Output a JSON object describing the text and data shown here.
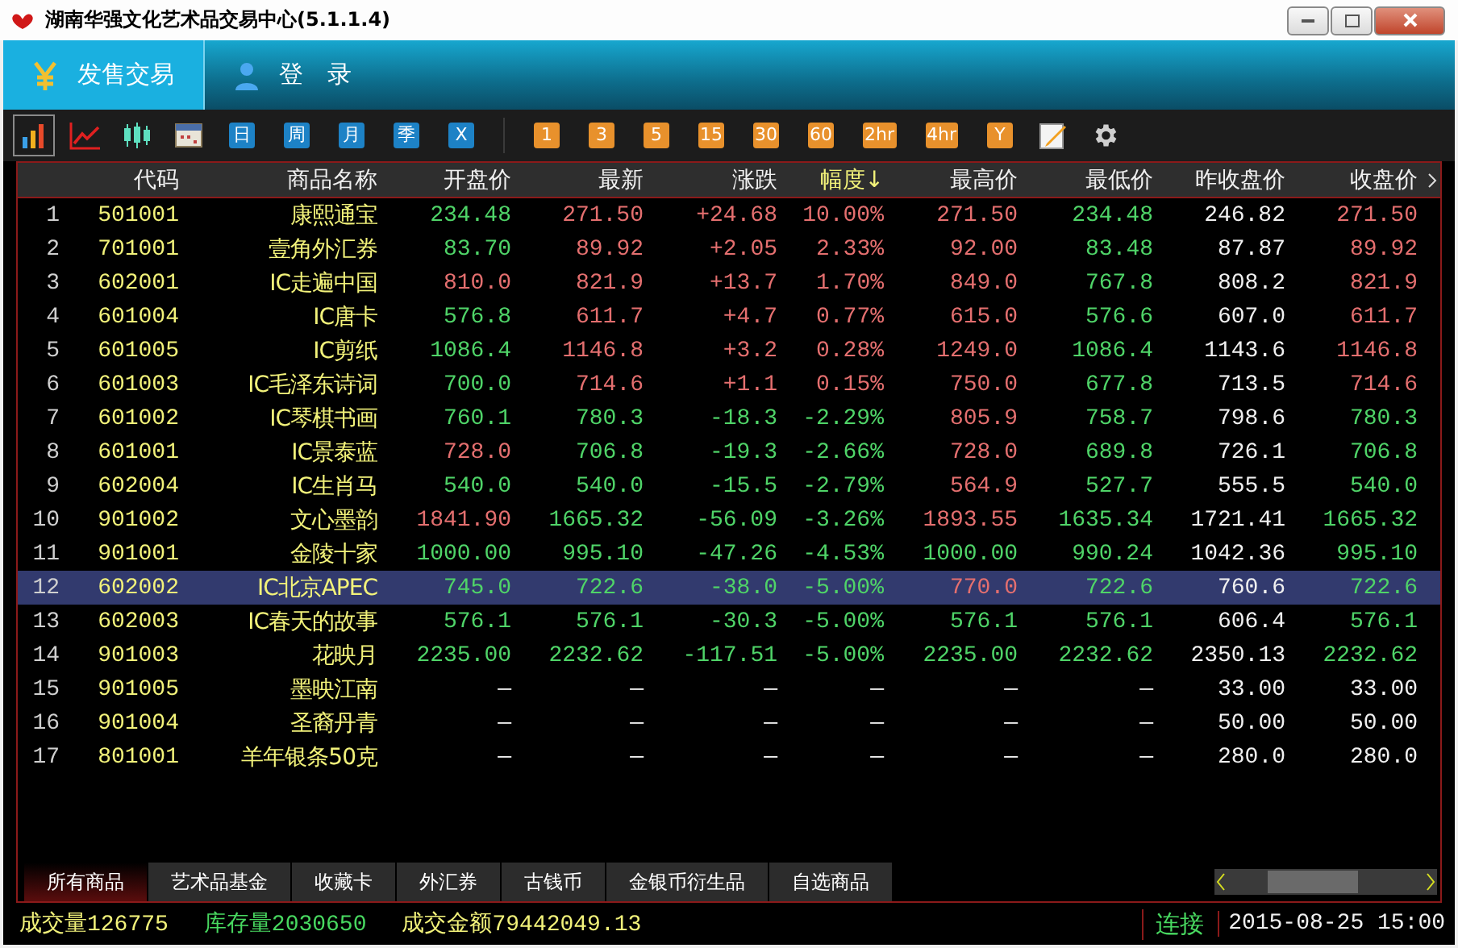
{
  "window": {
    "title": "湖南华强文化艺术品交易中心(5.1.1.4)"
  },
  "nav_tabs": [
    {
      "label": "发售交易",
      "kind": "trade",
      "selected": true
    },
    {
      "label": "登 录",
      "kind": "login",
      "selected": false
    }
  ],
  "toolbar": {
    "views": [
      {
        "kind": "bars",
        "selected": true
      },
      {
        "kind": "line",
        "selected": false
      },
      {
        "kind": "candles",
        "selected": false
      },
      {
        "kind": "calendar",
        "selected": false
      }
    ],
    "periods": [
      {
        "label": "日"
      },
      {
        "label": "周"
      },
      {
        "label": "月"
      },
      {
        "label": "季"
      },
      {
        "label": "X"
      }
    ],
    "intervals": [
      {
        "label": "1"
      },
      {
        "label": "3"
      },
      {
        "label": "5"
      },
      {
        "label": "15"
      },
      {
        "label": "30"
      },
      {
        "label": "60"
      },
      {
        "label": "2hr"
      },
      {
        "label": "4hr"
      },
      {
        "label": "Y"
      }
    ],
    "tools": [
      {
        "kind": "note"
      },
      {
        "kind": "settings"
      }
    ]
  },
  "table": {
    "columns": [
      {
        "label": "代码",
        "sorted": false
      },
      {
        "label": "商品名称",
        "sorted": false
      },
      {
        "label": "开盘价",
        "sorted": false
      },
      {
        "label": "最新",
        "sorted": false
      },
      {
        "label": "涨跌",
        "sorted": false
      },
      {
        "label": "幅度↓",
        "sorted": true
      },
      {
        "label": "最高价",
        "sorted": false
      },
      {
        "label": "最低价",
        "sorted": false
      },
      {
        "label": "昨收盘价",
        "sorted": false
      },
      {
        "label": "收盘价",
        "sorted": false
      }
    ],
    "rows": [
      {
        "selected": false,
        "no": "1",
        "cells": [
          {
            "text": "501001",
            "color": "#f2f27a"
          },
          {
            "text": "康熙通宝",
            "color": "#f2f27a"
          },
          {
            "text": "234.48",
            "color": "#4fd468"
          },
          {
            "text": "271.50",
            "color": "#e46f6f"
          },
          {
            "text": "+24.68",
            "color": "#e46f6f"
          },
          {
            "text": "10.00%",
            "color": "#e46f6f"
          },
          {
            "text": "271.50",
            "color": "#e46f6f"
          },
          {
            "text": "234.48",
            "color": "#4fd468"
          },
          {
            "text": "246.82",
            "color": "#f0f0f0"
          },
          {
            "text": "271.50",
            "color": "#e46f6f"
          }
        ]
      },
      {
        "selected": false,
        "no": "2",
        "cells": [
          {
            "text": "701001",
            "color": "#f2f27a"
          },
          {
            "text": "壹角外汇券",
            "color": "#f2f27a"
          },
          {
            "text": "83.70",
            "color": "#4fd468"
          },
          {
            "text": "89.92",
            "color": "#e46f6f"
          },
          {
            "text": "+2.05",
            "color": "#e46f6f"
          },
          {
            "text": "2.33%",
            "color": "#e46f6f"
          },
          {
            "text": "92.00",
            "color": "#e46f6f"
          },
          {
            "text": "83.48",
            "color": "#4fd468"
          },
          {
            "text": "87.87",
            "color": "#f0f0f0"
          },
          {
            "text": "89.92",
            "color": "#e46f6f"
          }
        ]
      },
      {
        "selected": false,
        "no": "3",
        "cells": [
          {
            "text": "602001",
            "color": "#f2f27a"
          },
          {
            "text": "IC走遍中国",
            "color": "#f2f27a"
          },
          {
            "text": "810.0",
            "color": "#e46f6f"
          },
          {
            "text": "821.9",
            "color": "#e46f6f"
          },
          {
            "text": "+13.7",
            "color": "#e46f6f"
          },
          {
            "text": "1.70%",
            "color": "#e46f6f"
          },
          {
            "text": "849.0",
            "color": "#e46f6f"
          },
          {
            "text": "767.8",
            "color": "#4fd468"
          },
          {
            "text": "808.2",
            "color": "#f0f0f0"
          },
          {
            "text": "821.9",
            "color": "#e46f6f"
          }
        ]
      },
      {
        "selected": false,
        "no": "4",
        "cells": [
          {
            "text": "601004",
            "color": "#f2f27a"
          },
          {
            "text": "IC唐卡",
            "color": "#f2f27a"
          },
          {
            "text": "576.8",
            "color": "#4fd468"
          },
          {
            "text": "611.7",
            "color": "#e46f6f"
          },
          {
            "text": "+4.7",
            "color": "#e46f6f"
          },
          {
            "text": "0.77%",
            "color": "#e46f6f"
          },
          {
            "text": "615.0",
            "color": "#e46f6f"
          },
          {
            "text": "576.6",
            "color": "#4fd468"
          },
          {
            "text": "607.0",
            "color": "#f0f0f0"
          },
          {
            "text": "611.7",
            "color": "#e46f6f"
          }
        ]
      },
      {
        "selected": false,
        "no": "5",
        "cells": [
          {
            "text": "601005",
            "color": "#f2f27a"
          },
          {
            "text": "IC剪纸",
            "color": "#f2f27a"
          },
          {
            "text": "1086.4",
            "color": "#4fd468"
          },
          {
            "text": "1146.8",
            "color": "#e46f6f"
          },
          {
            "text": "+3.2",
            "color": "#e46f6f"
          },
          {
            "text": "0.28%",
            "color": "#e46f6f"
          },
          {
            "text": "1249.0",
            "color": "#e46f6f"
          },
          {
            "text": "1086.4",
            "color": "#4fd468"
          },
          {
            "text": "1143.6",
            "color": "#f0f0f0"
          },
          {
            "text": "1146.8",
            "color": "#e46f6f"
          }
        ]
      },
      {
        "selected": false,
        "no": "6",
        "cells": [
          {
            "text": "601003",
            "color": "#f2f27a"
          },
          {
            "text": "IC毛泽东诗词",
            "color": "#f2f27a"
          },
          {
            "text": "700.0",
            "color": "#4fd468"
          },
          {
            "text": "714.6",
            "color": "#e46f6f"
          },
          {
            "text": "+1.1",
            "color": "#e46f6f"
          },
          {
            "text": "0.15%",
            "color": "#e46f6f"
          },
          {
            "text": "750.0",
            "color": "#e46f6f"
          },
          {
            "text": "677.8",
            "color": "#4fd468"
          },
          {
            "text": "713.5",
            "color": "#f0f0f0"
          },
          {
            "text": "714.6",
            "color": "#e46f6f"
          }
        ]
      },
      {
        "selected": false,
        "no": "7",
        "cells": [
          {
            "text": "601002",
            "color": "#f2f27a"
          },
          {
            "text": "IC琴棋书画",
            "color": "#f2f27a"
          },
          {
            "text": "760.1",
            "color": "#4fd468"
          },
          {
            "text": "780.3",
            "color": "#4fd468"
          },
          {
            "text": "-18.3",
            "color": "#4fd468"
          },
          {
            "text": "-2.29%",
            "color": "#4fd468"
          },
          {
            "text": "805.9",
            "color": "#e46f6f"
          },
          {
            "text": "758.7",
            "color": "#4fd468"
          },
          {
            "text": "798.6",
            "color": "#f0f0f0"
          },
          {
            "text": "780.3",
            "color": "#4fd468"
          }
        ]
      },
      {
        "selected": false,
        "no": "8",
        "cells": [
          {
            "text": "601001",
            "color": "#f2f27a"
          },
          {
            "text": "IC景泰蓝",
            "color": "#f2f27a"
          },
          {
            "text": "728.0",
            "color": "#e46f6f"
          },
          {
            "text": "706.8",
            "color": "#4fd468"
          },
          {
            "text": "-19.3",
            "color": "#4fd468"
          },
          {
            "text": "-2.66%",
            "color": "#4fd468"
          },
          {
            "text": "728.0",
            "color": "#e46f6f"
          },
          {
            "text": "689.8",
            "color": "#4fd468"
          },
          {
            "text": "726.1",
            "color": "#f0f0f0"
          },
          {
            "text": "706.8",
            "color": "#4fd468"
          }
        ]
      },
      {
        "selected": false,
        "no": "9",
        "cells": [
          {
            "text": "602004",
            "color": "#f2f27a"
          },
          {
            "text": "IC生肖马",
            "color": "#f2f27a"
          },
          {
            "text": "540.0",
            "color": "#4fd468"
          },
          {
            "text": "540.0",
            "color": "#4fd468"
          },
          {
            "text": "-15.5",
            "color": "#4fd468"
          },
          {
            "text": "-2.79%",
            "color": "#4fd468"
          },
          {
            "text": "564.9",
            "color": "#e46f6f"
          },
          {
            "text": "527.7",
            "color": "#4fd468"
          },
          {
            "text": "555.5",
            "color": "#f0f0f0"
          },
          {
            "text": "540.0",
            "color": "#4fd468"
          }
        ]
      },
      {
        "selected": false,
        "no": "10",
        "cells": [
          {
            "text": "901002",
            "color": "#f2f27a"
          },
          {
            "text": "文心墨韵",
            "color": "#f2f27a"
          },
          {
            "text": "1841.90",
            "color": "#e46f6f"
          },
          {
            "text": "1665.32",
            "color": "#4fd468"
          },
          {
            "text": "-56.09",
            "color": "#4fd468"
          },
          {
            "text": "-3.26%",
            "color": "#4fd468"
          },
          {
            "text": "1893.55",
            "color": "#e46f6f"
          },
          {
            "text": "1635.34",
            "color": "#4fd468"
          },
          {
            "text": "1721.41",
            "color": "#f0f0f0"
          },
          {
            "text": "1665.32",
            "color": "#4fd468"
          }
        ]
      },
      {
        "selected": false,
        "no": "11",
        "cells": [
          {
            "text": "901001",
            "color": "#f2f27a"
          },
          {
            "text": "金陵十家",
            "color": "#f2f27a"
          },
          {
            "text": "1000.00",
            "color": "#4fd468"
          },
          {
            "text": "995.10",
            "color": "#4fd468"
          },
          {
            "text": "-47.26",
            "color": "#4fd468"
          },
          {
            "text": "-4.53%",
            "color": "#4fd468"
          },
          {
            "text": "1000.00",
            "color": "#4fd468"
          },
          {
            "text": "990.24",
            "color": "#4fd468"
          },
          {
            "text": "1042.36",
            "color": "#f0f0f0"
          },
          {
            "text": "995.10",
            "color": "#4fd468"
          }
        ]
      },
      {
        "selected": true,
        "no": "12",
        "cells": [
          {
            "text": "602002",
            "color": "#f2f27a"
          },
          {
            "text": "IC北京APEC",
            "color": "#f2f27a"
          },
          {
            "text": "745.0",
            "color": "#4fd468"
          },
          {
            "text": "722.6",
            "color": "#4fd468"
          },
          {
            "text": "-38.0",
            "color": "#4fd468"
          },
          {
            "text": "-5.00%",
            "color": "#4fd468"
          },
          {
            "text": "770.0",
            "color": "#e46f6f"
          },
          {
            "text": "722.6",
            "color": "#4fd468"
          },
          {
            "text": "760.6",
            "color": "#f0f0f0"
          },
          {
            "text": "722.6",
            "color": "#4fd468"
          }
        ]
      },
      {
        "selected": false,
        "no": "13",
        "cells": [
          {
            "text": "602003",
            "color": "#f2f27a"
          },
          {
            "text": "IC春天的故事",
            "color": "#f2f27a"
          },
          {
            "text": "576.1",
            "color": "#4fd468"
          },
          {
            "text": "576.1",
            "color": "#4fd468"
          },
          {
            "text": "-30.3",
            "color": "#4fd468"
          },
          {
            "text": "-5.00%",
            "color": "#4fd468"
          },
          {
            "text": "576.1",
            "color": "#4fd468"
          },
          {
            "text": "576.1",
            "color": "#4fd468"
          },
          {
            "text": "606.4",
            "color": "#f0f0f0"
          },
          {
            "text": "576.1",
            "color": "#4fd468"
          }
        ]
      },
      {
        "selected": false,
        "no": "14",
        "cells": [
          {
            "text": "901003",
            "color": "#f2f27a"
          },
          {
            "text": "花映月",
            "color": "#f2f27a"
          },
          {
            "text": "2235.00",
            "color": "#4fd468"
          },
          {
            "text": "2232.62",
            "color": "#4fd468"
          },
          {
            "text": "-117.51",
            "color": "#4fd468"
          },
          {
            "text": "-5.00%",
            "color": "#4fd468"
          },
          {
            "text": "2235.00",
            "color": "#4fd468"
          },
          {
            "text": "2232.62",
            "color": "#4fd468"
          },
          {
            "text": "2350.13",
            "color": "#f0f0f0"
          },
          {
            "text": "2232.62",
            "color": "#4fd468"
          }
        ]
      },
      {
        "selected": false,
        "no": "15",
        "cells": [
          {
            "text": "901005",
            "color": "#f2f27a"
          },
          {
            "text": "墨映江南",
            "color": "#f2f27a"
          },
          {
            "text": "—",
            "color": "#f0f0f0"
          },
          {
            "text": "—",
            "color": "#f0f0f0"
          },
          {
            "text": "—",
            "color": "#f0f0f0"
          },
          {
            "text": "—",
            "color": "#f0f0f0"
          },
          {
            "text": "—",
            "color": "#f0f0f0"
          },
          {
            "text": "—",
            "color": "#f0f0f0"
          },
          {
            "text": "33.00",
            "color": "#f0f0f0"
          },
          {
            "text": "33.00",
            "color": "#f0f0f0"
          }
        ]
      },
      {
        "selected": false,
        "no": "16",
        "cells": [
          {
            "text": "901004",
            "color": "#f2f27a"
          },
          {
            "text": "圣裔丹青",
            "color": "#f2f27a"
          },
          {
            "text": "—",
            "color": "#f0f0f0"
          },
          {
            "text": "—",
            "color": "#f0f0f0"
          },
          {
            "text": "—",
            "color": "#f0f0f0"
          },
          {
            "text": "—",
            "color": "#f0f0f0"
          },
          {
            "text": "—",
            "color": "#f0f0f0"
          },
          {
            "text": "—",
            "color": "#f0f0f0"
          },
          {
            "text": "50.00",
            "color": "#f0f0f0"
          },
          {
            "text": "50.00",
            "color": "#f0f0f0"
          }
        ]
      },
      {
        "selected": false,
        "no": "17",
        "cells": [
          {
            "text": "801001",
            "color": "#f2f27a"
          },
          {
            "text": "羊年银条50克",
            "color": "#f2f27a"
          },
          {
            "text": "—",
            "color": "#f0f0f0"
          },
          {
            "text": "—",
            "color": "#f0f0f0"
          },
          {
            "text": "—",
            "color": "#f0f0f0"
          },
          {
            "text": "—",
            "color": "#f0f0f0"
          },
          {
            "text": "—",
            "color": "#f0f0f0"
          },
          {
            "text": "—",
            "color": "#f0f0f0"
          },
          {
            "text": "280.0",
            "color": "#f0f0f0"
          },
          {
            "text": "280.0",
            "color": "#f0f0f0"
          }
        ]
      }
    ]
  },
  "category_tabs": [
    {
      "label": "所有商品",
      "selected": true
    },
    {
      "label": "艺术品基金",
      "selected": false
    },
    {
      "label": "收藏卡",
      "selected": false
    },
    {
      "label": "外汇券",
      "selected": false
    },
    {
      "label": "古钱币",
      "selected": false
    },
    {
      "label": "金银币衍生品",
      "selected": false
    },
    {
      "label": "自选商品",
      "selected": false
    }
  ],
  "status_bar": {
    "stats": [
      {
        "text": "成交量126775",
        "color": "#f2f27a"
      },
      {
        "text": "库存量2030650",
        "color": "#48d860"
      },
      {
        "text": "成交金额79442049.13",
        "color": "#f2f27a"
      }
    ],
    "connection": {
      "text": "连接",
      "color": "#48d860"
    },
    "datetime": "2015-08-25 15:00"
  }
}
